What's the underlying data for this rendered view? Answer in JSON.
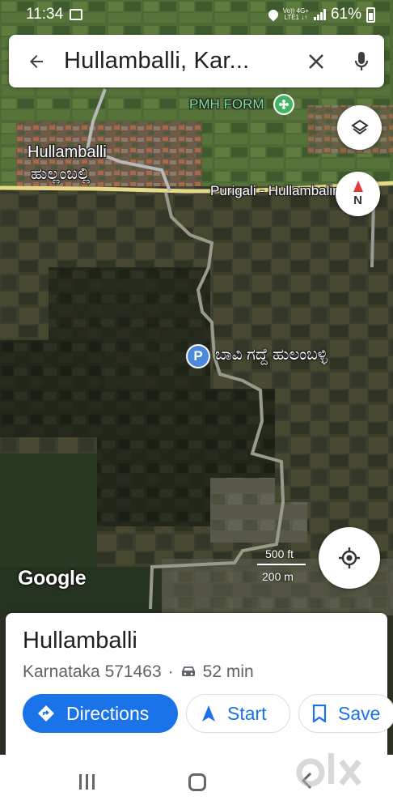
{
  "status_bar": {
    "time": "11:34",
    "network_top": "Vo)) 4G+",
    "network_bottom": "LTE1 ↓↑",
    "battery": "61%"
  },
  "search": {
    "query": "Hullamballi, Kar..."
  },
  "map": {
    "village_label": "Hullamballi",
    "village_label_kannada": "ಹುಲ್ಲಂಬಲ್ಲಿ",
    "farm_label": "PMH FORM",
    "road_label": "Purigali - Hullambalim",
    "place_label": "ಬಾವಿ ಗದ್ದೆ ಹುಲಂಬಳ್ಳಿ",
    "parking_glyph": "P",
    "compass_letter": "N",
    "logo": "Google",
    "scale_ft": "500 ft",
    "scale_m": "200 m"
  },
  "sheet": {
    "title": "Hullamballi",
    "address": "Karnataka 571463",
    "separator": "·",
    "drive_time": "52 min",
    "directions_label": "Directions",
    "start_label": "Start",
    "save_label": "Save"
  },
  "watermark": "olx",
  "colors": {
    "accent": "#1a73e8",
    "map_dark": "#2c3124",
    "road_yellow": "#e8d98a"
  }
}
